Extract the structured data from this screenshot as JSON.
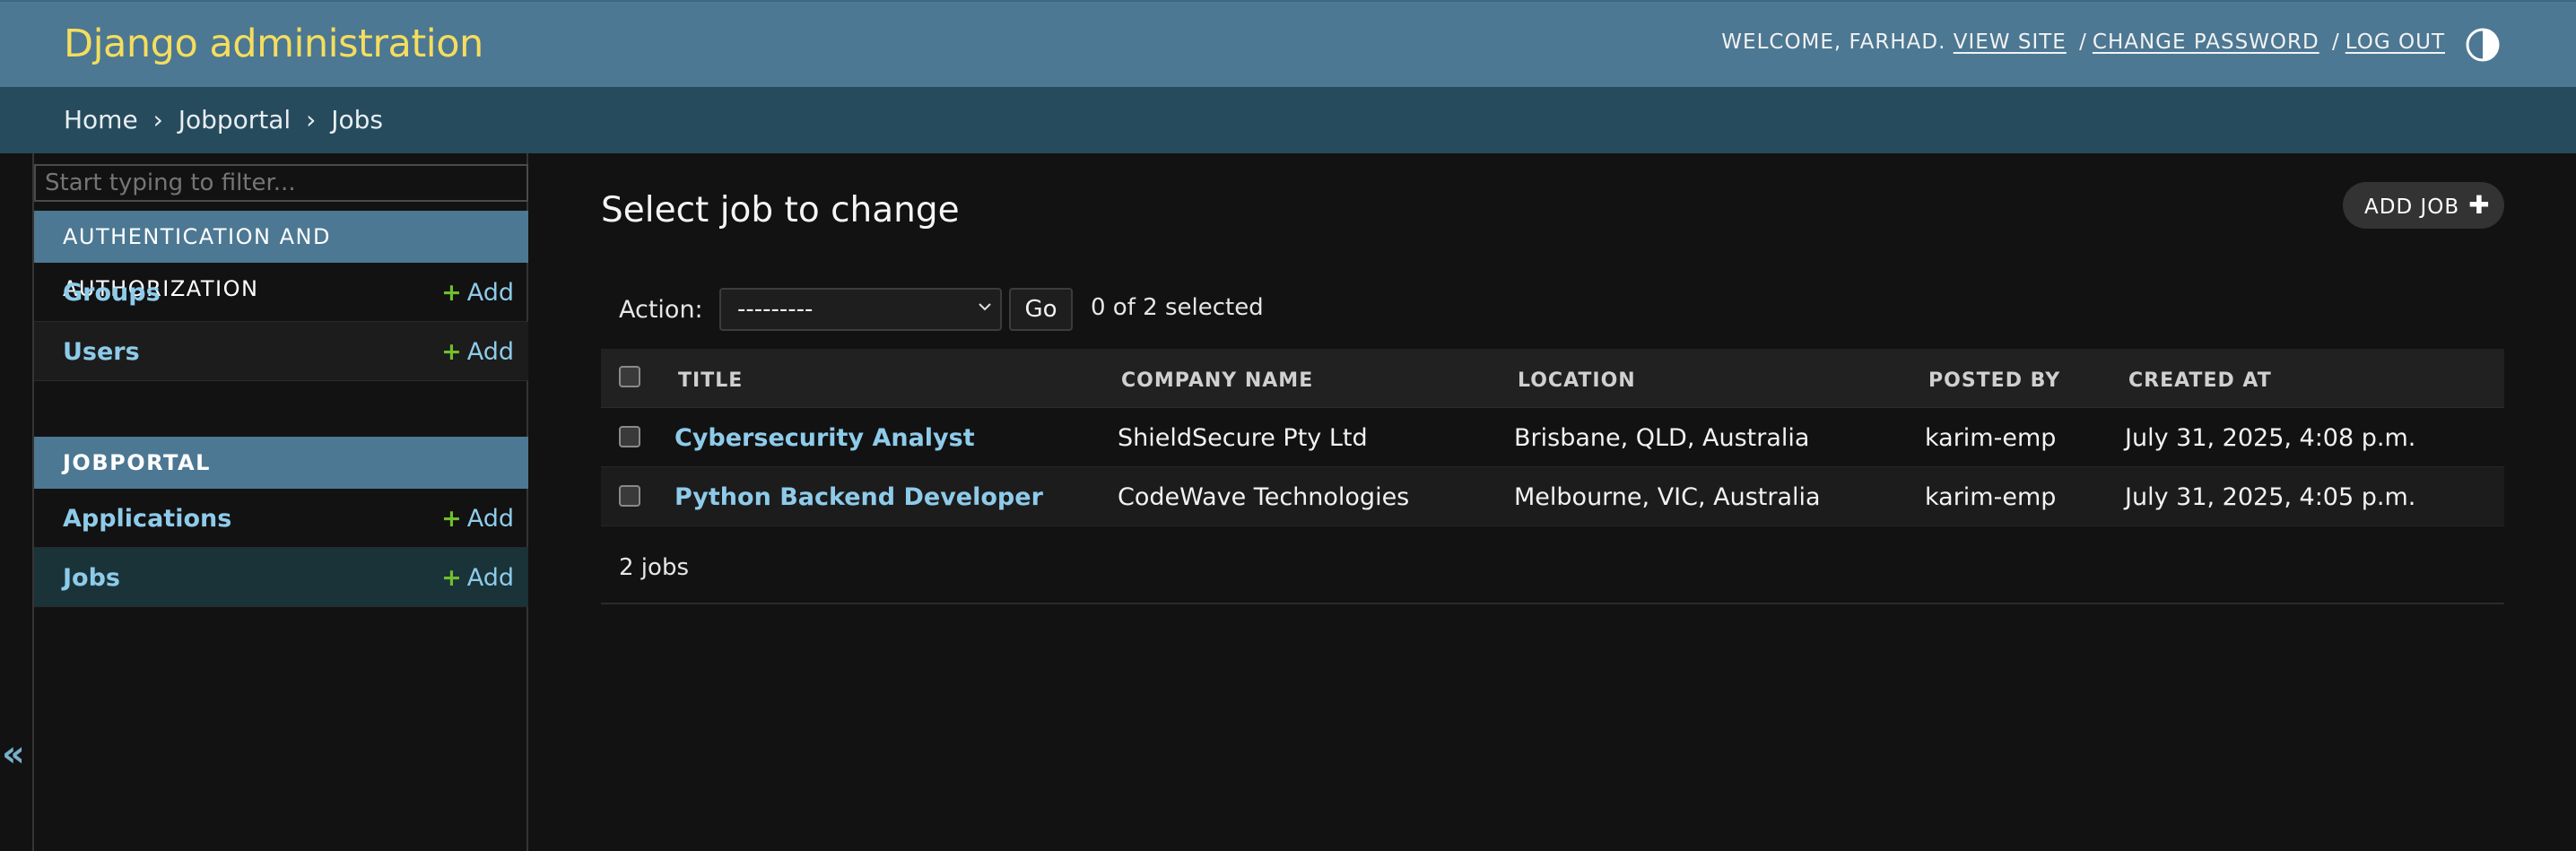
{
  "header": {
    "brand": "Django administration",
    "welcome": "WELCOME, FARHAD.",
    "view_site": "VIEW SITE",
    "change_password": "CHANGE PASSWORD",
    "log_out": "LOG OUT",
    "separator": "/",
    "theme_icon": "half-circle-contrast-icon"
  },
  "breadcrumbs": {
    "home": "Home",
    "app": "Jobportal",
    "current": "Jobs",
    "arrow": "›"
  },
  "sidebar": {
    "filter_placeholder": "Start typing to filter...",
    "collapse_glyph": "«",
    "modules": [
      {
        "caption": "AUTHENTICATION AND AUTHORIZATION",
        "models": [
          {
            "name": "Groups",
            "add": "Add"
          },
          {
            "name": "Users",
            "add": "Add"
          }
        ]
      },
      {
        "caption": "JOBPORTAL",
        "models": [
          {
            "name": "Applications",
            "add": "Add"
          },
          {
            "name": "Jobs",
            "add": "Add"
          }
        ]
      }
    ]
  },
  "content": {
    "title": "Select job to change",
    "add_button": "ADD JOB",
    "add_glyph": "✚",
    "action_label": "Action:",
    "action_value": "---------",
    "go_button": "Go",
    "selected_count": "0 of 2 selected",
    "columns": [
      "TITLE",
      "COMPANY NAME",
      "LOCATION",
      "POSTED BY",
      "CREATED AT"
    ],
    "rows": [
      {
        "title": "Cybersecurity Analyst",
        "company": "ShieldSecure Pty Ltd",
        "location": "Brisbane, QLD, Australia",
        "posted_by": "karim-emp",
        "created_at": "July 31, 2025, 4:08 p.m."
      },
      {
        "title": "Python Backend Developer",
        "company": "CodeWave Technologies",
        "location": "Melbourne, VIC, Australia",
        "posted_by": "karim-emp",
        "created_at": "July 31, 2025, 4:05 p.m."
      }
    ],
    "paginator": "2 jobs"
  },
  "colors": {
    "header_bg": "#4c7893",
    "brand": "#f5dd5d",
    "breadcrumbs_bg": "#264b5d",
    "link": "#8ecbea",
    "add_plus": "#70bf2b",
    "body_bg": "#121212"
  }
}
